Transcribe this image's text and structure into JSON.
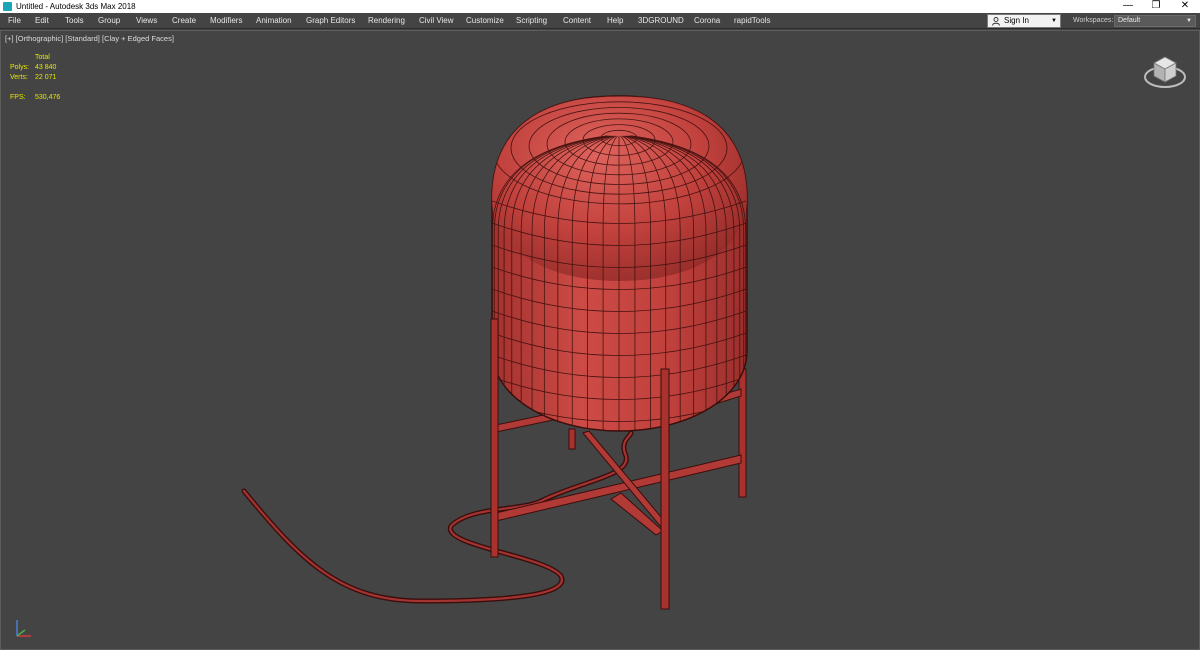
{
  "window": {
    "title": "Untitled - Autodesk 3ds Max 2018",
    "minimize_glyph": "—",
    "restore_glyph": "❐",
    "close_glyph": "✕"
  },
  "menu": {
    "items": [
      "File",
      "Edit",
      "Tools",
      "Group",
      "Views",
      "Create",
      "Modifiers",
      "Animation",
      "Graph Editors",
      "Rendering",
      "Civil View",
      "Customize",
      "Scripting",
      "Content",
      "Help",
      "3DGROUND",
      "Corona",
      "rapidTools"
    ]
  },
  "signin": {
    "label": "Sign In",
    "icon": "user-icon"
  },
  "workspace": {
    "label": "Workspaces:",
    "value": "Default"
  },
  "viewport": {
    "label_plus": "[+]",
    "label_view": "[Orthographic]",
    "label_shading_standard": "[Standard]",
    "label_shading_mode": "[Clay + Edged Faces]",
    "stats": {
      "header": "Total",
      "polys_label": "Polys:",
      "polys_value": "43 840",
      "verts_label": "Verts:",
      "verts_value": "22 071",
      "fps_label": "FPS:",
      "fps_value": "530,476"
    }
  },
  "colors": {
    "viewport_bg": "#444444",
    "object_red": "#c2413d",
    "wire": "#3a0e0c",
    "stats_yellow": "#e6e600"
  }
}
